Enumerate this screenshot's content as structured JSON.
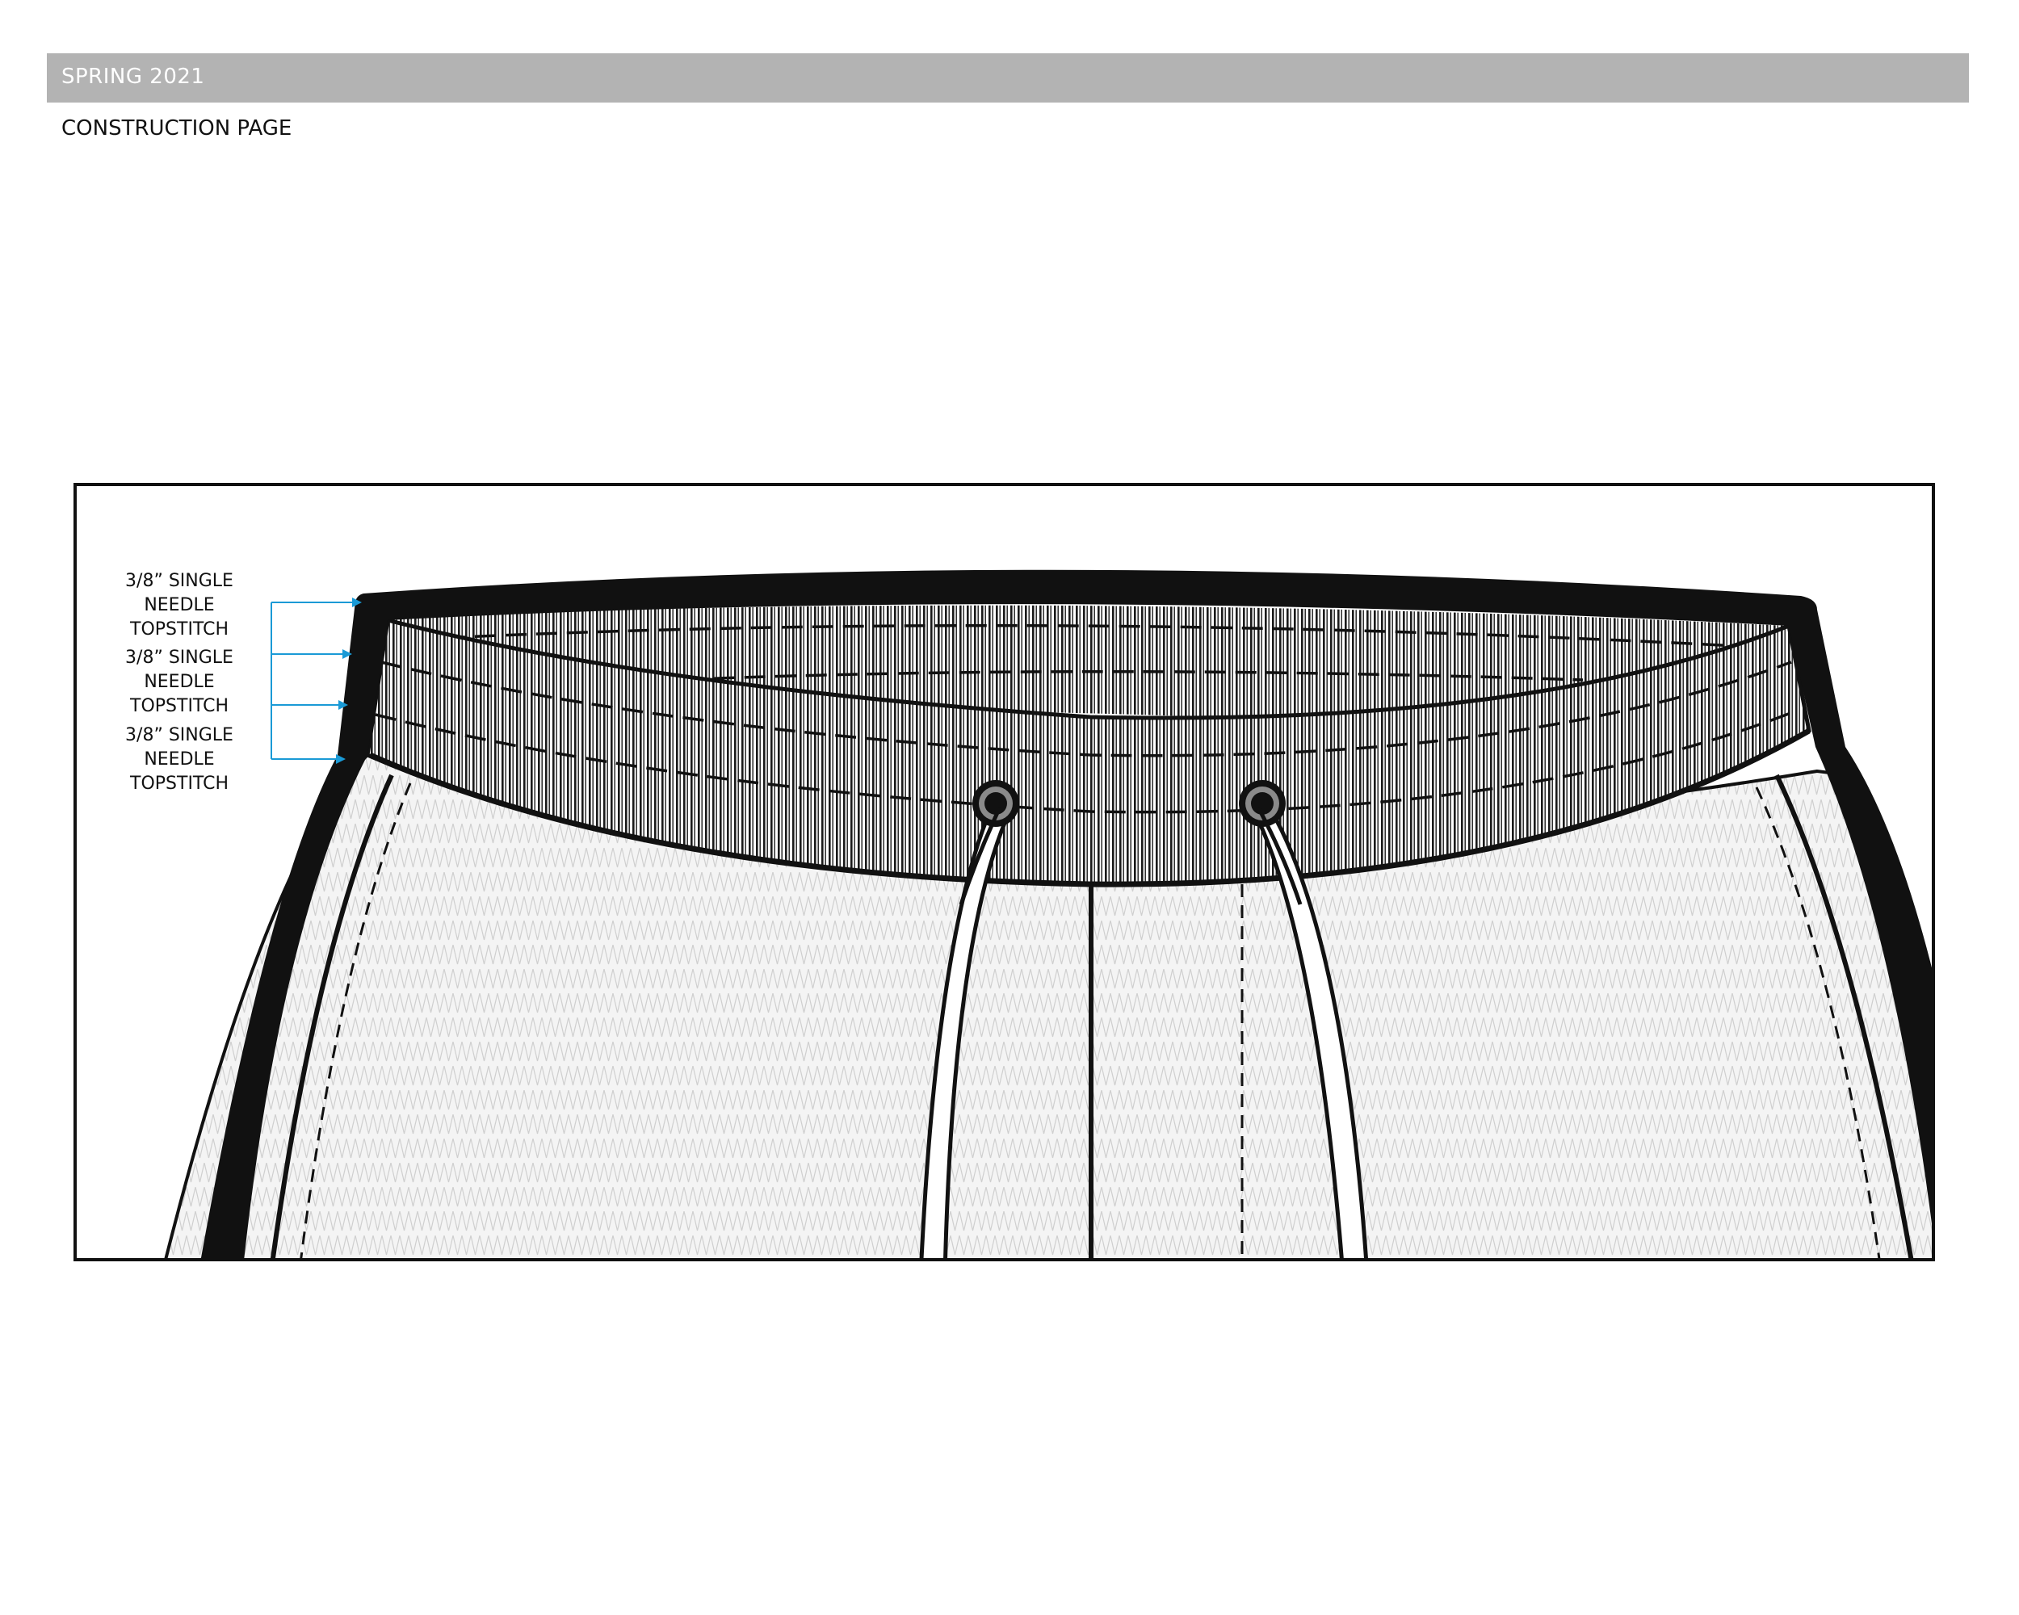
{
  "header": {
    "season": "SPRING 2021",
    "page_title": "CONSTRUCTION PAGE"
  },
  "callouts": [
    {
      "line1": "3/8” SINGLE",
      "line2": "NEEDLE",
      "line3": "TOPSTITCH"
    },
    {
      "line1": "3/8” SINGLE",
      "line2": "NEEDLE",
      "line3": "TOPSTITCH"
    },
    {
      "line1": "3/8” SINGLE",
      "line2": "NEEDLE",
      "line3": "TOPSTITCH"
    }
  ],
  "colors": {
    "header_bar": "#b3b3b3",
    "callout_arrow": "#1a9ad6",
    "outline": "#111111",
    "knit_fill": "#ededed"
  }
}
